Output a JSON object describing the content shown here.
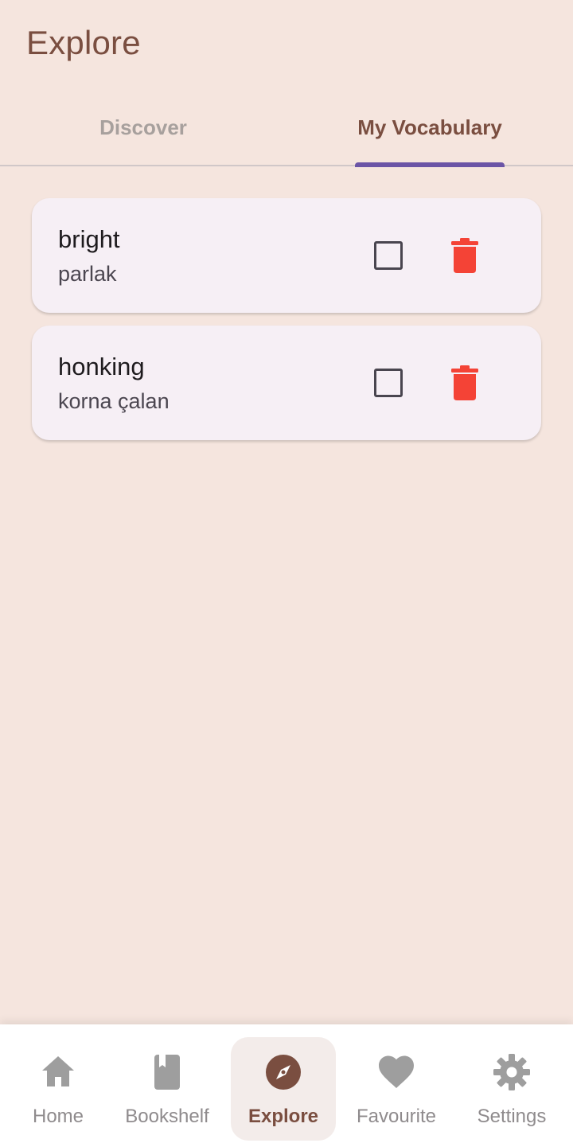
{
  "header": {
    "title": "Explore"
  },
  "tabs": [
    {
      "label": "Discover",
      "selected": false
    },
    {
      "label": "My Vocabulary",
      "selected": true
    }
  ],
  "words": [
    {
      "term": "bright",
      "translation": "parlak",
      "learned": false
    },
    {
      "term": "honking",
      "translation": "korna çalan",
      "learned": false
    }
  ],
  "nav": [
    {
      "label": "Home",
      "icon": "home-icon"
    },
    {
      "label": "Bookshelf",
      "icon": "book-icon"
    },
    {
      "label": "Explore",
      "icon": "compass-icon",
      "active": true
    },
    {
      "label": "Favourite",
      "icon": "heart-icon"
    },
    {
      "label": "Settings",
      "icon": "gear-icon"
    }
  ],
  "colors": {
    "background": "#f5e5de",
    "accent_brown": "#7a4e40",
    "tab_indicator": "#6b54a6",
    "delete_red": "#f44336",
    "inactive_icon": "#9e9e9e"
  }
}
